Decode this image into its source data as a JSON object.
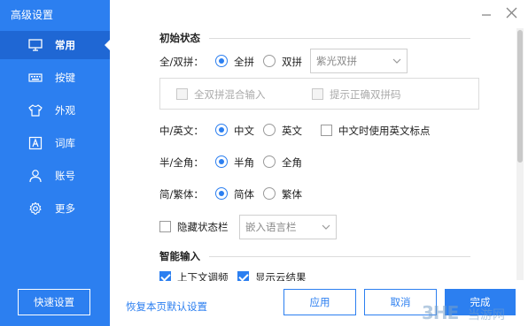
{
  "window": {
    "title": "高级设置"
  },
  "sidebar": {
    "items": [
      {
        "label": "常用",
        "icon": "monitor-icon"
      },
      {
        "label": "按键",
        "icon": "keyboard-icon"
      },
      {
        "label": "外观",
        "icon": "shirt-icon"
      },
      {
        "label": "词库",
        "icon": "dictionary-icon"
      },
      {
        "label": "账号",
        "icon": "user-icon"
      },
      {
        "label": "更多",
        "icon": "gear-icon"
      }
    ],
    "active_index": 0,
    "quick_settings_label": "快速设置"
  },
  "main": {
    "initial_state_title": "初始状态",
    "pinyin": {
      "label": "全/双拼：",
      "options": [
        "全拼",
        "双拼"
      ],
      "selected": "全拼",
      "scheme_value": "紫光双拼",
      "mixed_input_label": "全双拼混合输入",
      "hint_label": "提示正确双拼码"
    },
    "lang": {
      "label": "中/英文：",
      "options": [
        "中文",
        "英文"
      ],
      "selected": "中文",
      "english_punct_label": "中文时使用英文标点"
    },
    "width": {
      "label": "半/全角：",
      "options": [
        "半角",
        "全角"
      ],
      "selected": "半角"
    },
    "script": {
      "label": "简/繁体：",
      "options": [
        "简体",
        "繁体"
      ],
      "selected": "简体"
    },
    "statusbar": {
      "hide_label": "隐藏状态栏",
      "embed_value": "嵌入语言栏"
    },
    "smart_input_title": "智能输入",
    "smart_input_options": [
      "上下文调频",
      "显示云结果"
    ]
  },
  "footer": {
    "restore_label": "恢复本页默认设置",
    "apply_label": "应用",
    "cancel_label": "取消",
    "done_label": "完成"
  },
  "watermark": {
    "logo": "3HE",
    "text": "当游网"
  },
  "colors": {
    "accent": "#2c7ff0",
    "sidebar_bg": "#2c7ff0",
    "sidebar_active": "#1f67d4"
  }
}
